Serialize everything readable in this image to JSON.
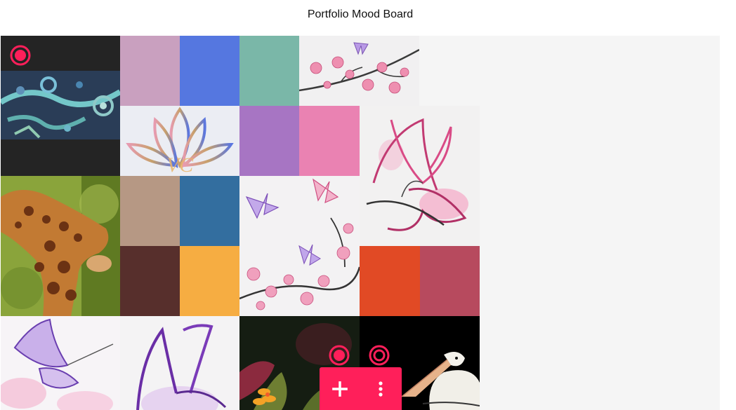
{
  "page": {
    "title": "Portfolio Mood Board"
  },
  "colors": {
    "accent": "#ff1f5a",
    "board_background": "#f5f5f5",
    "swatch_1": "#c9a0bf",
    "swatch_2": "#5577e0",
    "swatch_3": "#7ab7a8",
    "swatch_4": "#a775c3",
    "swatch_5": "#ea82b2",
    "swatch_6": "#b69884",
    "swatch_7": "#336e9f",
    "swatch_8": "#572f2c",
    "swatch_9": "#f6ad42",
    "swatch_10": "#e14a25",
    "swatch_11": "#b74a5e"
  },
  "logo": {
    "monogram": "VC"
  },
  "fab": {
    "add_icon": "plus-icon",
    "menu_icon": "more-vertical-icon"
  },
  "tiles": [
    "beaded-embroidery-photo",
    "pink-swatch",
    "blue-swatch",
    "teal-swatch",
    "cherry-blossom-branch-illustration",
    "lotus-logo",
    "purple-swatch",
    "pink-swatch-2",
    "pink-butterfly-sketch",
    "giraffe-photo",
    "tan-swatch",
    "steel-blue-swatch",
    "butterflies-and-blossoms-illustration",
    "dark-brown-swatch",
    "orange-swatch",
    "red-orange-swatch",
    "raspberry-swatch",
    "purple-butterfly-watercolor",
    "purple-butterfly-sketch",
    "flower-photo",
    "pelican-photo"
  ]
}
